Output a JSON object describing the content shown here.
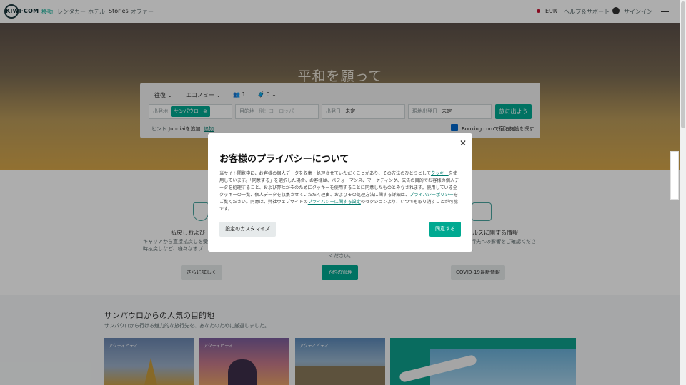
{
  "header": {
    "logo": "KIWI·COM",
    "nav": [
      "移動",
      "レンタカー",
      "ホテル",
      "Stories",
      "オファー"
    ],
    "currency": "EUR",
    "help": "ヘルプ＆サポート",
    "signin": "サインイン"
  },
  "hero": {
    "title": "平和を願って",
    "trip_type": "往復",
    "cabin": "エコノミー",
    "passengers": "1",
    "bags": "0",
    "origin_label": "出発地",
    "origin_chip": "サンパウロ",
    "destination_label": "目的地",
    "destination_placeholder": "例：ヨーロッパ",
    "depart_label": "出発日",
    "depart_value": "未定",
    "return_label": "現地出発日",
    "return_value": "未定",
    "search_button": "旅に出よう",
    "hint_label": "ヒント",
    "hint_text": "Jundiaiを追加",
    "hint_link": "追加",
    "booking_text": "Booking.comで宿泊施設を探す"
  },
  "middle": {
    "left_title": "払戻しおよび",
    "left_text": "キャリアから直接払戻しを受…\n時払戻しなど、様々なオプ…",
    "left_button": "さらに詳しく",
    "center_text": "ください。",
    "center_button": "予約の管理",
    "right_title": "ルスに関する情報",
    "right_text": "旅行先への影響をご確認くださ\nい。",
    "right_button": "COVID-19最新情報"
  },
  "popular": {
    "title": "サンパウロからの人気の目的地",
    "subtitle": "サンパウロから行ける魅力的な旅行先を、あなたのために厳選しました。",
    "cards": [
      "アクティビティ",
      "アクティビティ",
      "アクティビティ"
    ]
  },
  "modal": {
    "title": "お客様のプライバシーについて",
    "body_1": "当サイト閲覧中に、お客様の個人データを収集・処理させていただくことがあり、その方法のひとつとして",
    "body_link_1": "クッキー",
    "body_2": "を使用しています。「同意する」を選択した場合、お客様は、パフォーマンス、マーケティング、広告の目的でお客様の個人データを処理すること、および弊社がそのためにクッキーを使用することに同意したものとみなされます。使用している全クッキーの一覧、個人データを収集させていただく理由、およびその処理方法に関する詳細は、",
    "body_link_2": "プライバシーポリシー",
    "body_3": "をご覧ください。同意は、弊社ウェブサイトの",
    "body_link_3": "プライバシーに関する設定",
    "body_4": "のセクションより、いつでも取り消すことが可能です。",
    "customize_button": "設定のカスタマイズ",
    "agree_button": "同意する"
  }
}
